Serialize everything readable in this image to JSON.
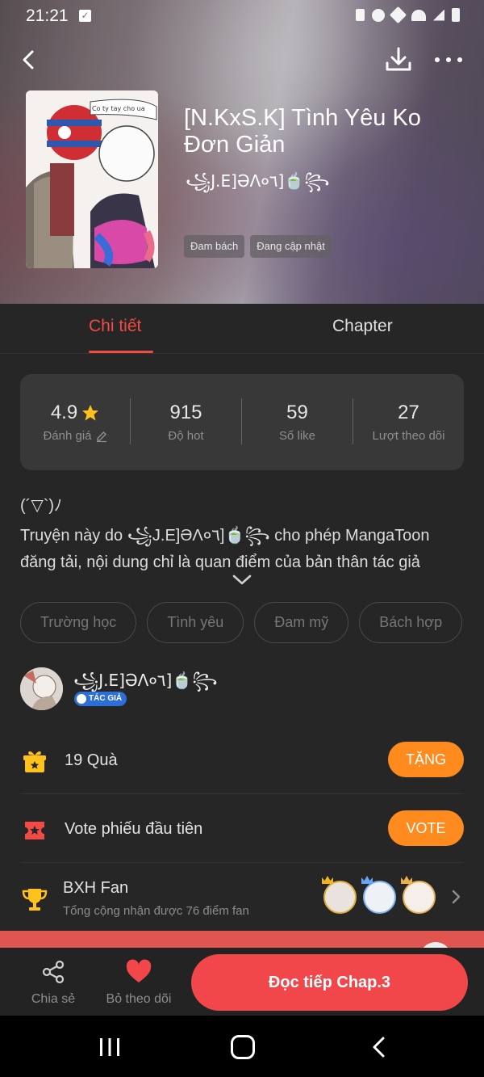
{
  "status_bar": {
    "time": "21:21"
  },
  "header": {
    "title": "[N.KxS.K] Tình Yêu Ko Đơn Giản",
    "author": "꧁J.E]ƏΛ०٦]🍵꧂",
    "tags": [
      "Đam bách",
      "Đang cập nhật"
    ],
    "cover_text": "Co ty tay cho ua"
  },
  "tabs": {
    "detail": "Chi tiết",
    "chapter": "Chapter"
  },
  "stats": {
    "rating": {
      "value": "4.9",
      "label": "Đánh giá"
    },
    "hot": {
      "value": "915",
      "label": "Độ hot"
    },
    "likes": {
      "value": "59",
      "label": "Số like"
    },
    "follows": {
      "value": "27",
      "label": "Lượt theo dõi"
    }
  },
  "description": {
    "line1": "(´▽`)ﾉ",
    "line2": "Truyện này do ꧁J.E]ƏΛ०٦]🍵꧂ cho phép MangaToon",
    "line3": "đăng tải, nội dung chỉ là quan điểm của bản thân tác giả"
  },
  "genres": [
    "Trường học",
    "Tình yêu",
    "Đam mỹ",
    "Bách hợp"
  ],
  "author": {
    "name": "꧁J.E]ƏΛ०٦]🍵꧂",
    "badge": "TÁC GIẢ"
  },
  "gift": {
    "label": "19  Quà",
    "button": "TẶNG"
  },
  "vote": {
    "label": "Vote phiếu đầu tiên",
    "button": "VOTE"
  },
  "fan_rank": {
    "title": "BXH Fan",
    "subtitle": "Tổng cộng nhận được 76 điểm fan"
  },
  "bottom_bar": {
    "share": "Chia sẻ",
    "unfollow": "Bỏ theo dõi",
    "continue": "Đọc tiếp Chap.3"
  },
  "colors": {
    "accent_red": "#f24a44",
    "accent_orange": "#ff8a1e",
    "background": "#262626",
    "card": "#383838",
    "star": "#ffc21a"
  },
  "icons": [
    "back-arrow-icon",
    "download-icon",
    "more-icon",
    "star-icon",
    "edit-icon",
    "chevron-down-icon",
    "gift-icon",
    "ticket-icon",
    "trophy-icon",
    "chevron-right-icon",
    "share-icon",
    "heart-icon"
  ]
}
